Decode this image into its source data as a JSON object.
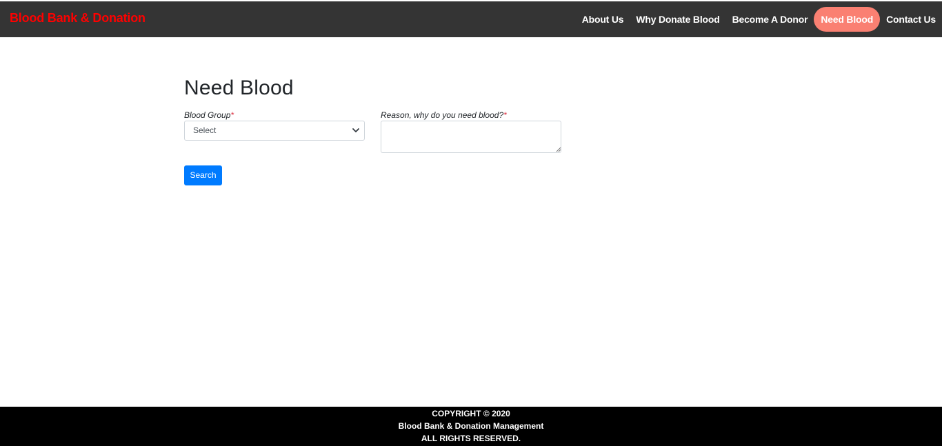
{
  "brand": "Blood Bank & Donation",
  "nav": [
    {
      "label": "About Us",
      "active": false
    },
    {
      "label": "Why Donate Blood",
      "active": false
    },
    {
      "label": "Become A Donor",
      "active": false
    },
    {
      "label": "Need Blood",
      "active": true
    },
    {
      "label": "Contact Us",
      "active": false
    }
  ],
  "colors": {
    "navbar": "#343434",
    "brand": "#ff0000",
    "active_nav": "#fa8072",
    "primary_button": "#007bff",
    "footer": "#000000",
    "required": "#dc3545"
  },
  "page": {
    "title": "Need Blood"
  },
  "form": {
    "blood_group": {
      "label": "Blood Group",
      "required_mark": "*",
      "selected": "Select"
    },
    "reason": {
      "label": "Reason, why do you need blood?",
      "required_mark": "*",
      "value": ""
    },
    "search_button": "Search"
  },
  "footer": {
    "line1": "COPYRIGHT © 2020",
    "line2": "Blood Bank & Donation Management",
    "line3": "ALL RIGHTS RESERVED."
  }
}
